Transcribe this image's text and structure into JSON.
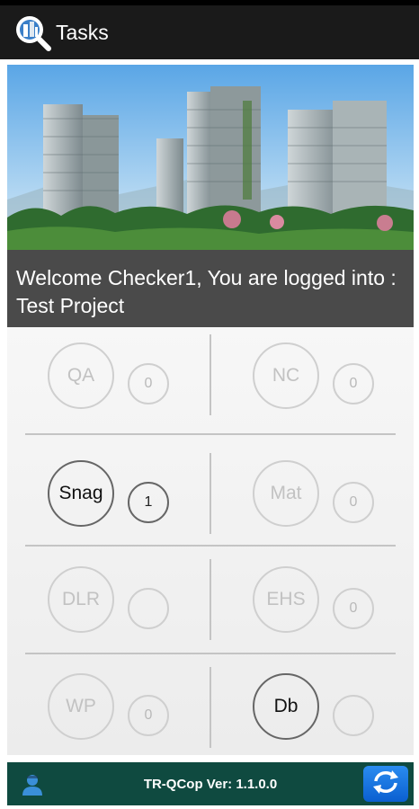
{
  "appbar": {
    "title": "Tasks",
    "logo_icon": "search-building-logo-icon"
  },
  "banner": {
    "image": "building-towers-photo",
    "welcome_text": "Welcome Checker1, You are logged into : Test Project"
  },
  "tasks": [
    {
      "label": "QA",
      "count": "0",
      "active": false
    },
    {
      "label": "NC",
      "count": "0",
      "active": false
    },
    {
      "label": "Snag",
      "count": "1",
      "active": true
    },
    {
      "label": "Mat",
      "count": "0",
      "active": false
    },
    {
      "label": "DLR",
      "count": "",
      "active": false
    },
    {
      "label": "EHS",
      "count": "0",
      "active": false
    },
    {
      "label": "WP",
      "count": "0",
      "active": false
    },
    {
      "label": "Db",
      "count": "",
      "active": true
    }
  ],
  "footer": {
    "version": "TR-QCop Ver: 1.1.0.0",
    "user_icon": "user-icon",
    "refresh_icon": "refresh-icon"
  },
  "colors": {
    "appbar": "#1a1a1a",
    "footer": "#0f4a40",
    "refresh": "#1e78e6"
  }
}
